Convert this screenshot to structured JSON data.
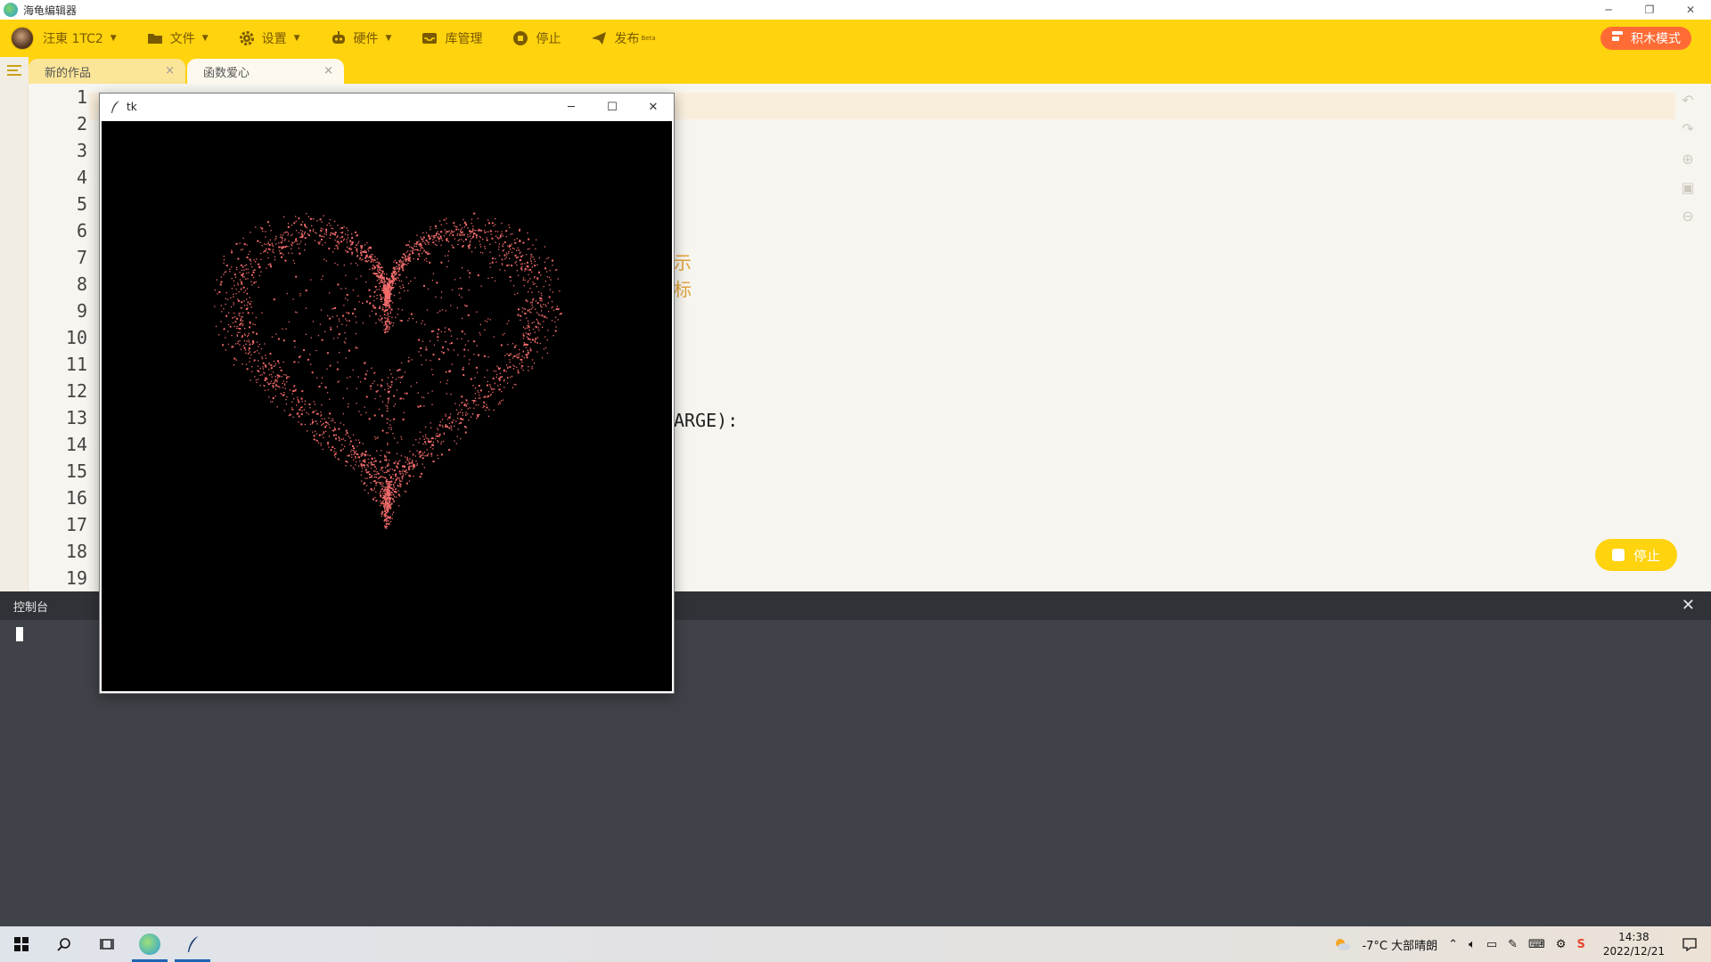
{
  "window": {
    "title": "海龟编辑器",
    "min_glyph": "─",
    "restore_glyph": "❐",
    "close_glyph": "✕"
  },
  "toolbar": {
    "user_label": "汪東 1TC2",
    "file_label": "文件",
    "settings_label": "设置",
    "hardware_label": "硬件",
    "library_label": "库管理",
    "stop_label": "停止",
    "publish_label": "发布",
    "publish_badge": "Beta",
    "block_mode_label": "积木模式"
  },
  "tabs": [
    {
      "label": "新的作品",
      "close": "×"
    },
    {
      "label": "函数爱心",
      "close": "×"
    }
  ],
  "editor": {
    "line_numbers": [
      "1",
      "2",
      "3",
      "4",
      "5",
      "6",
      "7",
      "8",
      "9",
      "10",
      "11",
      "12",
      "13",
      "14",
      "15",
      "16",
      "17",
      "18",
      "19"
    ],
    "visible_code": {
      "comment_1": "示",
      "comment_2": "标",
      "line_13": "ARGE):"
    },
    "stop_button_label": "停止"
  },
  "console": {
    "title": "控制台",
    "close_glyph": "✕"
  },
  "tk_window": {
    "title": "tk",
    "min_glyph": "─",
    "max_glyph": "☐",
    "close_glyph": "✕",
    "heart_color": "#f26b6b",
    "canvas_color": "#000000"
  },
  "taskbar": {
    "weather": "-7°C 大部晴朗",
    "time": "14:38",
    "date": "2022/12/21"
  },
  "colors": {
    "accent": "#ffd30e",
    "block_mode": "#ff6b35",
    "console_bg": "#3f4248"
  }
}
